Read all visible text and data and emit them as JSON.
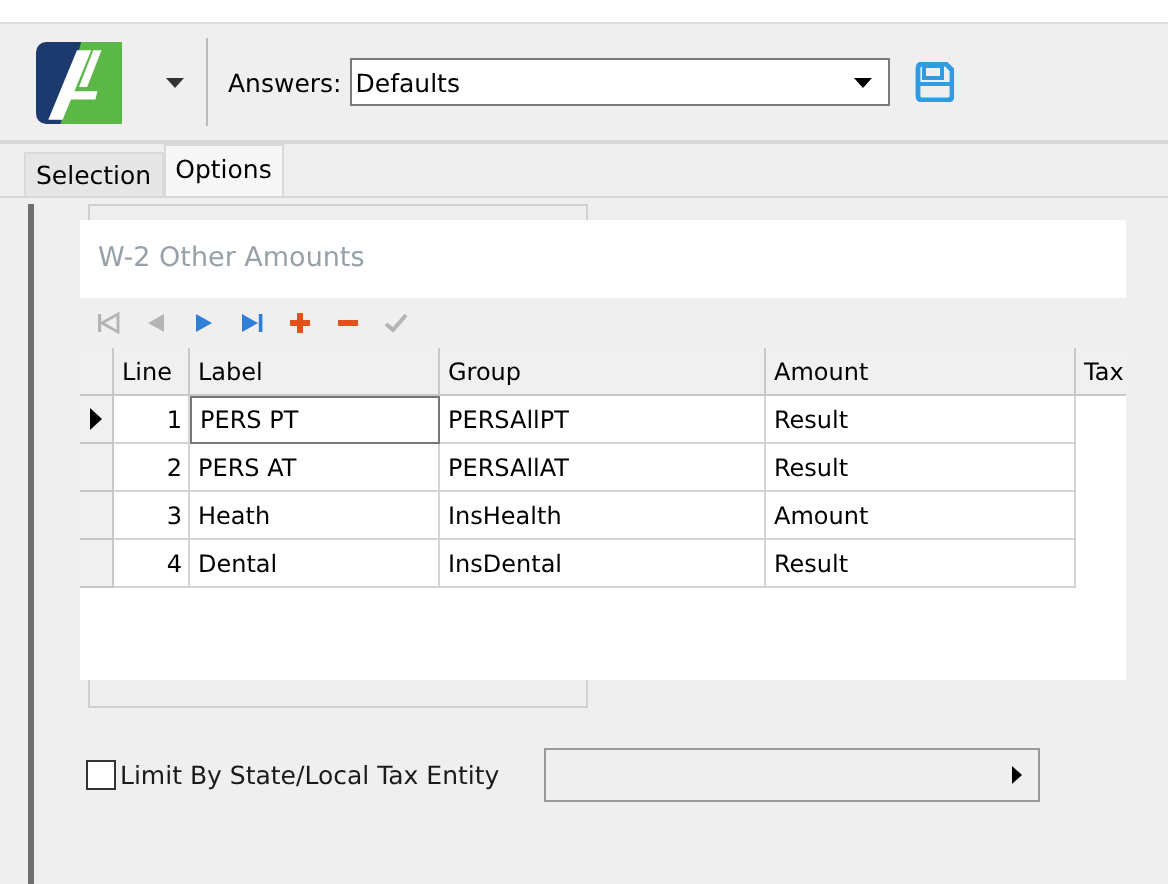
{
  "toolbar": {
    "answers_label": "Answers:",
    "answers_value": "Defaults"
  },
  "tabs": [
    {
      "label": "Selection",
      "selected": false
    },
    {
      "label": "Options",
      "selected": true
    }
  ],
  "popup": {
    "title": "W-2 Other Amounts",
    "nav": [
      {
        "kind": "first",
        "disabled": true
      },
      {
        "kind": "prev",
        "disabled": true
      },
      {
        "kind": "next",
        "disabled": false
      },
      {
        "kind": "last",
        "disabled": false
      },
      {
        "kind": "add",
        "disabled": false
      },
      {
        "kind": "remove",
        "disabled": false
      },
      {
        "kind": "post",
        "disabled": true
      }
    ],
    "columns": [
      "Line",
      "Label",
      "Group",
      "Amount",
      "Tax"
    ],
    "rows": [
      {
        "line": "1",
        "label": "PERS PT",
        "group": "PERSAllPT",
        "amount": "Result",
        "selected": true
      },
      {
        "line": "2",
        "label": "PERS AT",
        "group": "PERSAllAT",
        "amount": "Result",
        "selected": false
      },
      {
        "line": "3",
        "label": "Heath",
        "group": "InsHealth",
        "amount": "Amount",
        "selected": false
      },
      {
        "line": "4",
        "label": "Dental",
        "group": "InsDental",
        "amount": "Result",
        "selected": false
      }
    ]
  },
  "limit": {
    "label": "Limit By State/Local Tax Entity",
    "checked": false
  }
}
